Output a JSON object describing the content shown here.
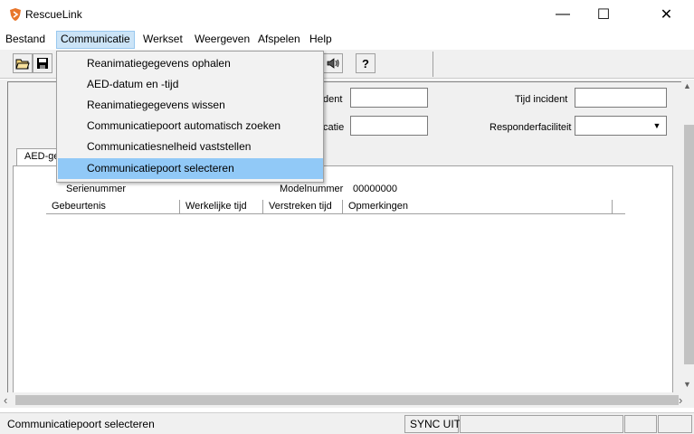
{
  "window": {
    "title": "RescueLink",
    "minimize_glyph": "—",
    "maximize_glyph": "☐",
    "close_glyph": "✕"
  },
  "menubar": {
    "items": [
      {
        "label": "Bestand"
      },
      {
        "label": "Communicatie"
      },
      {
        "label": "Werkset"
      },
      {
        "label": "Weergeven"
      },
      {
        "label": "Afspelen"
      },
      {
        "label": "Help"
      }
    ]
  },
  "communicatie_menu": {
    "items": [
      {
        "label": "Reanimatiegegevens ophalen"
      },
      {
        "label": "AED-datum en -tijd"
      },
      {
        "label": "Reanimatiegegevens wissen"
      },
      {
        "label": "Communicatiepoort automatisch zoeken"
      },
      {
        "label": "Communicatiesnelheid vaststellen"
      },
      {
        "label": "Communicatiepoort selecteren"
      }
    ],
    "selected_index": 5
  },
  "toolbar": {
    "icons": [
      "open-folder-icon",
      "save-icon",
      "speaker-icon",
      "help-question-icon"
    ],
    "speaker_glyph": "🔈",
    "help_glyph": "?"
  },
  "form": {
    "incident_label_partial": "dent",
    "tijd_incident_label": "Tijd incident",
    "locatie_label_partial": "catie",
    "responderfaciliteit_label": "Responderfaciliteit",
    "combo_arrow": "▼"
  },
  "tab": {
    "label": "AED-ge"
  },
  "details": {
    "serienummer_label": "Serienummer",
    "modelnummer_label": "Modelnummer",
    "modelnummer_value": "00000000"
  },
  "grid": {
    "columns": [
      "Gebeurtenis",
      "Werkelijke tijd",
      "Verstreken tijd",
      "Opmerkingen"
    ]
  },
  "scrollbars": {
    "up": "▲",
    "down": "▼",
    "left": "‹",
    "right": "›"
  },
  "statusbar": {
    "text": "Communicatiepoort selecteren",
    "sync": "SYNC UIT"
  },
  "colors": {
    "accent": "#91c9f7",
    "menu_hover": "#cce4f7",
    "chrome": "#f0f0f0"
  }
}
